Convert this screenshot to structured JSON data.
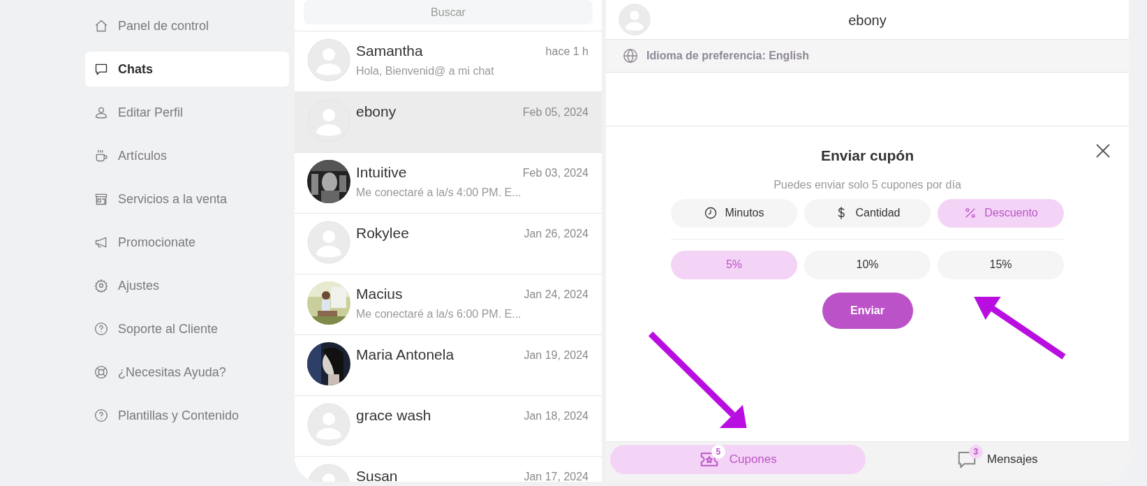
{
  "sidebar": {
    "items": [
      {
        "label": "Panel de control",
        "selected": false
      },
      {
        "label": "Chats",
        "selected": true
      },
      {
        "label": "Editar Perfil",
        "selected": false
      },
      {
        "label": "Artículos",
        "selected": false
      },
      {
        "label": "Servicios a la venta",
        "selected": false
      },
      {
        "label": "Promocionate",
        "selected": false
      },
      {
        "label": "Ajustes",
        "selected": false
      },
      {
        "label": "Soporte al Cliente",
        "selected": false
      },
      {
        "label": "¿Necesitas Ayuda?",
        "selected": false
      },
      {
        "label": "Plantillas y Contenido",
        "selected": false
      }
    ]
  },
  "chat_list": {
    "search": {
      "placeholder": "Buscar"
    },
    "chats": [
      {
        "name": "Samantha",
        "time": "hace 1 h",
        "preview": "Hola, Bienvenid@ a mi chat",
        "kind": "placeholder",
        "selected": false
      },
      {
        "name": "ebony",
        "time": "Feb 05, 2024",
        "kind": "placeholder",
        "selected": true
      },
      {
        "name": "Intuitive",
        "time": "Feb 03, 2024",
        "preview": "Me conectaré a la/s 4:00 PM. E...",
        "kind": "picture",
        "selected": false
      },
      {
        "name": "Rokylee",
        "time": "Jan 26, 2024",
        "kind": "placeholder",
        "selected": false
      },
      {
        "name": "Macius",
        "time": "Jan 24, 2024",
        "preview": "Me conectaré a la/s 6:00 PM. E...",
        "kind": "picture",
        "selected": false
      },
      {
        "name": "Maria Antonela",
        "time": "Jan 19, 2024",
        "kind": "picture",
        "selected": false
      },
      {
        "name": "grace wash",
        "time": "Jan 18, 2024",
        "kind": "placeholder",
        "selected": false
      },
      {
        "name": "Susan",
        "time": "Jan 17, 2024",
        "kind": "placeholder",
        "selected": false
      }
    ]
  },
  "conversation": {
    "header": {
      "name": "ebony"
    },
    "language": "Idioma de preferencia: English",
    "coupon": {
      "title": "Enviar cupón",
      "subtitle": "Puedes enviar solo 5 cupones por día",
      "types": [
        {
          "label": "Minutos",
          "selected": false
        },
        {
          "label": "Cantidad",
          "selected": false
        },
        {
          "label": "Descuento",
          "selected": true
        }
      ],
      "amounts": [
        {
          "label": "5%",
          "selected": true
        },
        {
          "label": "10%",
          "selected": false
        },
        {
          "label": "15%",
          "selected": false
        }
      ],
      "send_button": "Enviar"
    },
    "bottom_tabs": [
      {
        "label": "Cupones",
        "badge": "5",
        "selected": true
      },
      {
        "label": "Mensajes",
        "badge": "3",
        "selected": false
      }
    ]
  }
}
